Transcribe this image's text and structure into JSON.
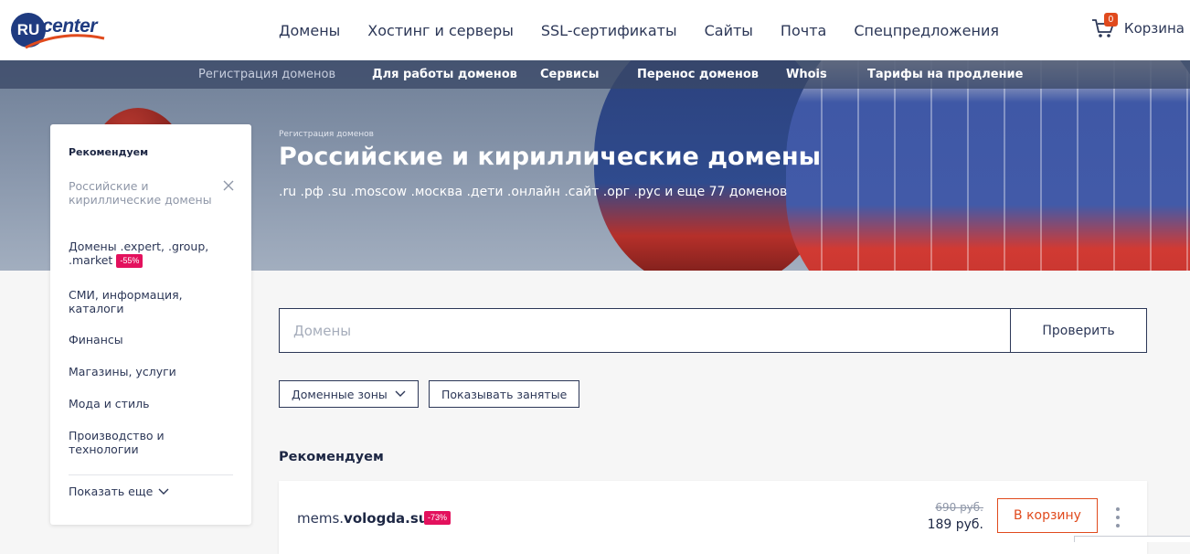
{
  "header": {
    "logo": {
      "badge": "RU",
      "word": "center"
    },
    "nav": [
      "Домены",
      "Хостинг и серверы",
      "SSL-сертификаты",
      "Сайты",
      "Почта",
      "Спецпредложения"
    ],
    "cart": {
      "count": "0",
      "label": "Корзина",
      "icon": "cart-icon"
    }
  },
  "subnav": {
    "items": [
      {
        "label": "Регистрация доменов",
        "active": true
      },
      {
        "label": "Для работы доменов",
        "active": false
      },
      {
        "label": "Сервисы",
        "active": false
      },
      {
        "label": "Перенос доменов",
        "active": false
      },
      {
        "label": "Whois",
        "active": false
      },
      {
        "label": "Тарифы на продление",
        "active": false
      }
    ]
  },
  "hero": {
    "breadcrumb": "Регистрация доменов",
    "title": "Российские и кириллические домены",
    "subtitle": ".ru .рф .su .moscow .москва .дети .онлайн .сайт .орг .рус и еще 77 доменов"
  },
  "sidebar": {
    "heading": "Рекомендуем",
    "items": [
      {
        "label": "Российские и кириллические домены",
        "active": true
      },
      {
        "label": "Домены .expert, .group, .market",
        "tag": "-55%"
      },
      {
        "label": "СМИ, информация, каталоги"
      },
      {
        "label": "Финансы"
      },
      {
        "label": "Магазины, услуги"
      },
      {
        "label": "Мода и стиль"
      },
      {
        "label": "Производство и технологии"
      }
    ],
    "show_more": "Показать еще"
  },
  "search": {
    "placeholder": "Домены",
    "value": "",
    "button": "Проверить"
  },
  "filters": {
    "zones": "Доменные зоны",
    "show_taken": "Показывать занятые"
  },
  "recommended": {
    "title": "Рекомендуем",
    "items": [
      {
        "prefix": "mems.",
        "zone": "vologda.su",
        "discount": "-73%",
        "old_price": "690 руб.",
        "price": "189 руб.",
        "action": "В корзину"
      }
    ]
  },
  "colors": {
    "navy": "#1d2744",
    "accent": "#e04a1d",
    "tag": "#e3115d",
    "subnav_bg": "#3a4866"
  }
}
